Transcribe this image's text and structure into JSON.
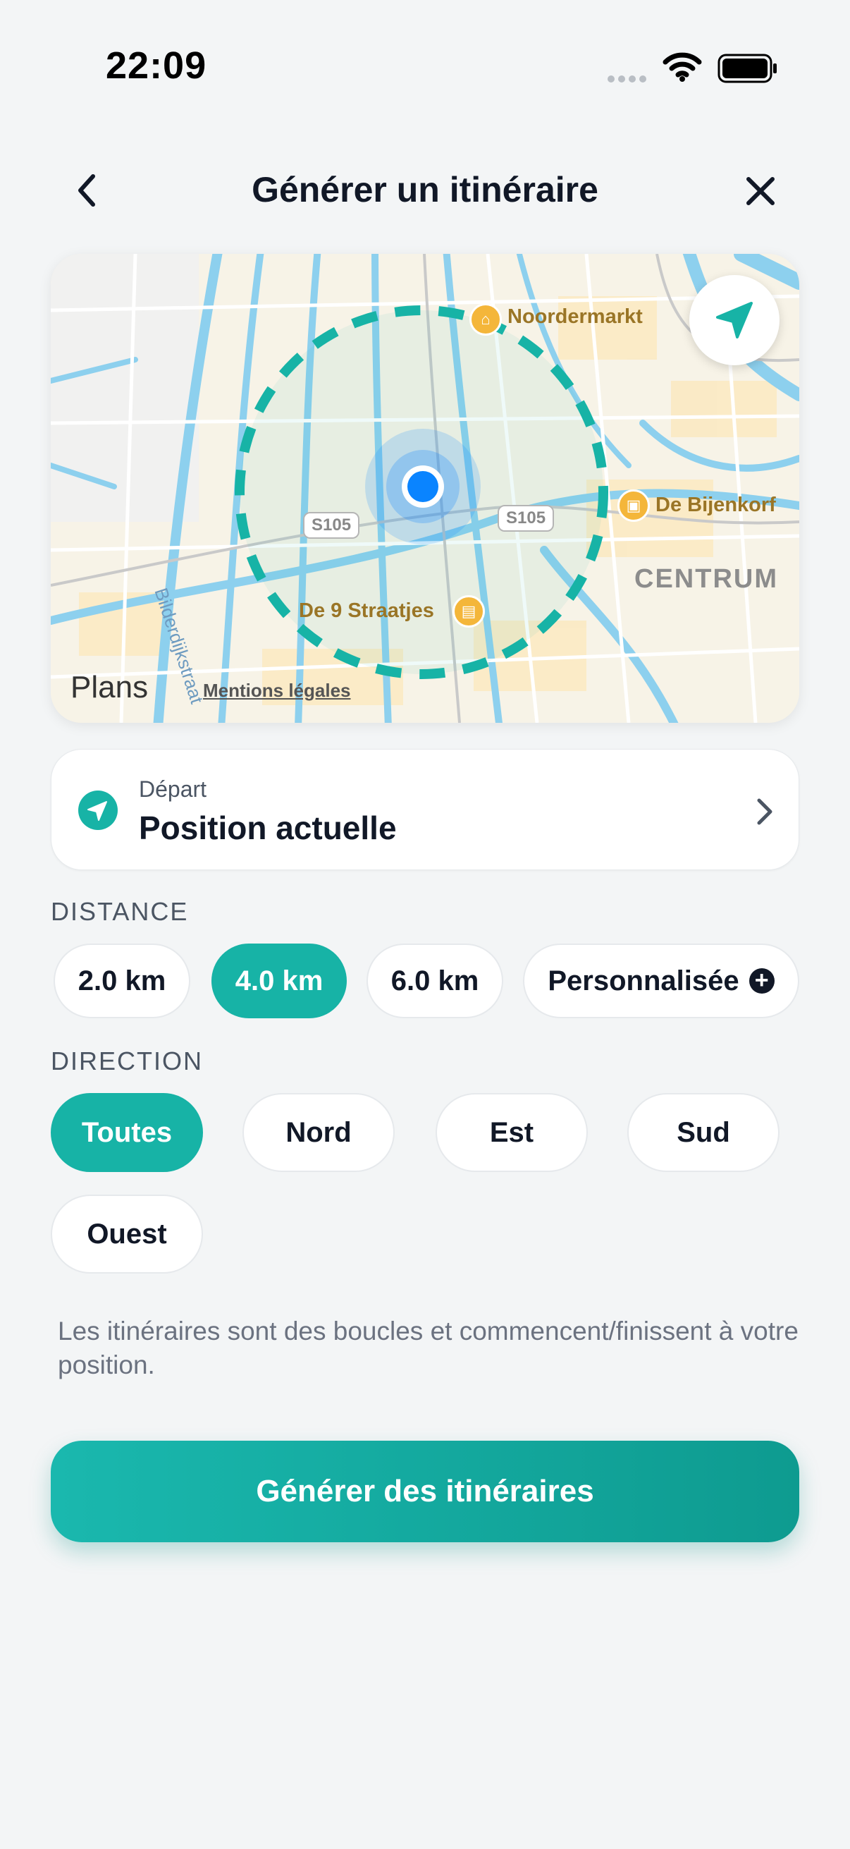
{
  "status_bar": {
    "time": "22:09"
  },
  "header": {
    "title": "Générer un itinéraire"
  },
  "map": {
    "labels": {
      "noordermarkt": "Noordermarkt",
      "bijenkorf": "De Bijenkorf",
      "straatjes": "De 9 Straatjes",
      "centrum": "CENTRUM",
      "road_1": "S105",
      "road_2": "S105",
      "street": "Bilderdijkstraat"
    },
    "attribution": "Plans",
    "legal_link": "Mentions légales",
    "route_color": "#17b3a6",
    "location_color": "#0a84ff"
  },
  "departure": {
    "label": "Départ",
    "value": "Position actuelle"
  },
  "distance": {
    "title": "DISTANCE",
    "options": [
      "2.0 km",
      "4.0 km",
      "6.0 km",
      "Personnalisée"
    ],
    "selected": "4.0 km",
    "custom_icon": "plus-icon"
  },
  "direction": {
    "title": "DIRECTION",
    "options": [
      "Toutes",
      "Nord",
      "Est",
      "Sud",
      "Ouest"
    ],
    "selected": "Toutes"
  },
  "note": "Les itinéraires sont des boucles et commencent/finissent à votre position.",
  "generate_button": "Générer des itinéraires",
  "accent_color": "#17b3a6"
}
